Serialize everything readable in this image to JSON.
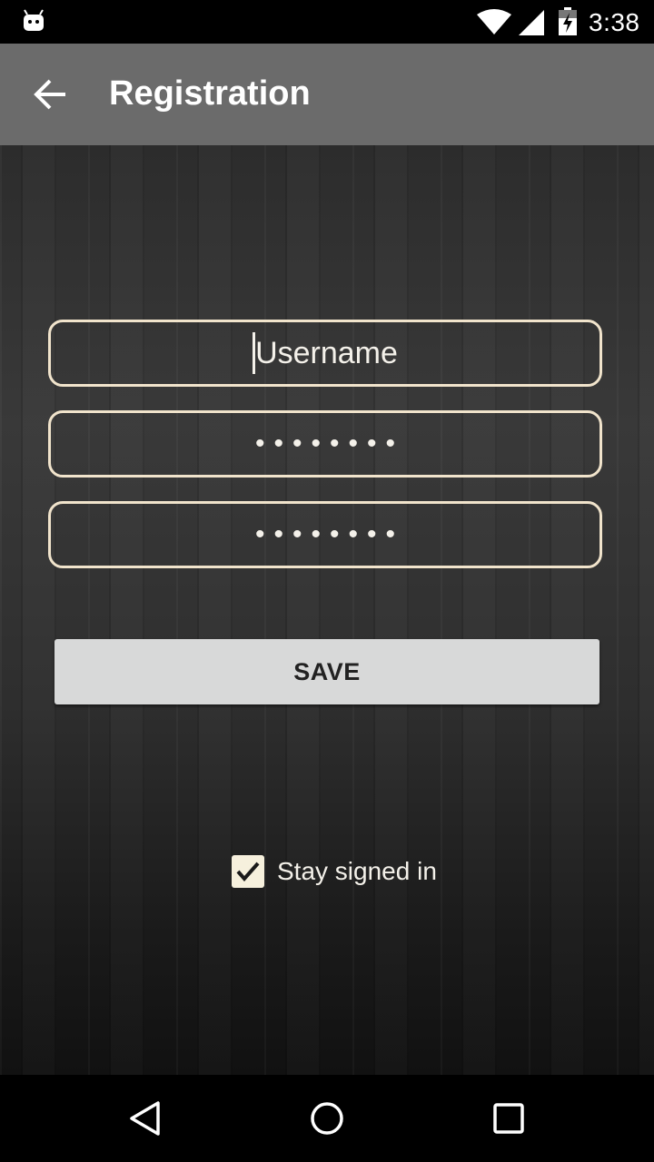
{
  "status_bar": {
    "time": "3:38",
    "icons": [
      "android-icon",
      "wifi-icon",
      "signal-icon",
      "battery-charging-icon"
    ]
  },
  "app_bar": {
    "title": "Registration",
    "back_icon": "arrow-back-icon"
  },
  "form": {
    "username": {
      "placeholder": "Username",
      "value": ""
    },
    "password": {
      "masked": "••••••••"
    },
    "confirm_password": {
      "masked": "••••••••"
    },
    "save_label": "SAVE",
    "stay_signed_in": {
      "label": "Stay signed in",
      "checked": true
    }
  },
  "nav_bar": {
    "icons": [
      "back-triangle-icon",
      "home-circle-icon",
      "recents-square-icon"
    ]
  },
  "colors": {
    "status_bar": "#000000",
    "app_bar": "#6b6b6b",
    "field_border": "#f1e4cc",
    "button_bg": "#d8d9d9",
    "text_light": "#f4f1ea"
  }
}
